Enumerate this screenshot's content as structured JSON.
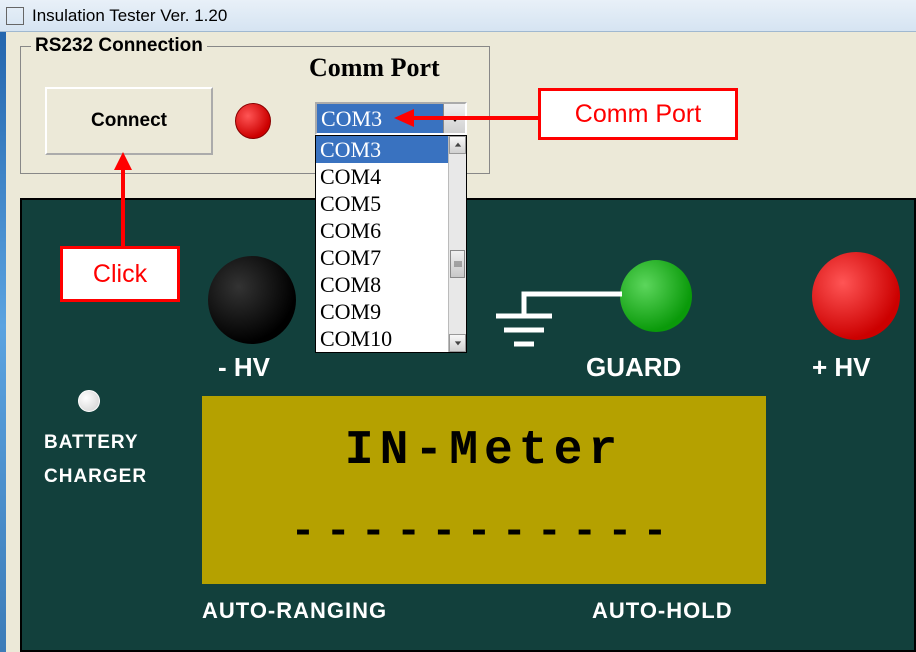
{
  "window": {
    "title": "Insulation Tester Ver. 1.20"
  },
  "groupbox": {
    "legend": "RS232 Connection",
    "connect_label": "Connect",
    "commport_label": "Comm Port",
    "selected_port": "COM3",
    "options": [
      "COM3",
      "COM4",
      "COM5",
      "COM6",
      "COM7",
      "COM8",
      "COM9",
      "COM10"
    ]
  },
  "panel": {
    "hv_neg": "- HV",
    "guard": "GUARD",
    "hv_pos": "+ HV",
    "battery": "BATTERY",
    "charger": "CHARGER",
    "lcd_title": "IN-Meter",
    "lcd_value": "-----------",
    "auto_ranging": "AUTO-RANGING",
    "auto_hold": "AUTO-HOLD"
  },
  "annotations": {
    "click": "Click",
    "commport": "Comm Port"
  }
}
